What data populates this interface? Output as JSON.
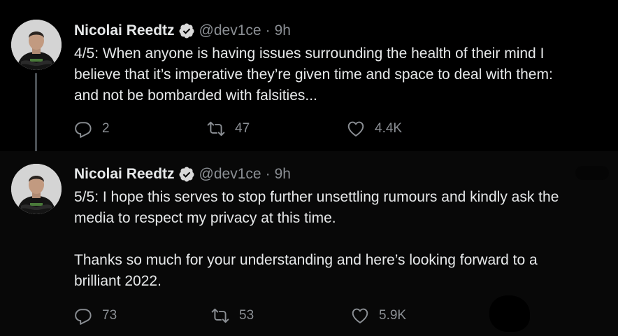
{
  "colors": {
    "background": "#000000",
    "reply_background": "#080808",
    "text_primary": "#e7e9ea",
    "text_secondary": "#8b8f94",
    "verified_badge": "#d9d9d9",
    "thread_line": "#4a4f54"
  },
  "icons": {
    "reply": "speech-bubble-icon",
    "retweet": "retweet-arrows-icon",
    "like": "heart-outline-icon",
    "verified": "verified-badge-icon"
  },
  "tweets": [
    {
      "author_name": "Nicolai Reedtz",
      "handle": "@dev1ce",
      "separator": "·",
      "time": "9h",
      "text": "4/5: When anyone is having issues surrounding the health of their mind I\nbelieve that it’s imperative they’re given time and space to deal with them:\nand not be bombarded with falsities...",
      "replies": "2",
      "retweets": "47",
      "likes": "4.4K"
    },
    {
      "author_name": "Nicolai Reedtz",
      "handle": "@dev1ce",
      "separator": "·",
      "time": "9h",
      "text": "5/5: I hope this serves to stop further unsettling rumours and kindly ask the\nmedia to respect my privacy at this time.\n\nThanks so much for your understanding and here’s looking forward to a\nbrilliant 2022.",
      "replies": "73",
      "retweets": "53",
      "likes": "5.9K"
    }
  ]
}
